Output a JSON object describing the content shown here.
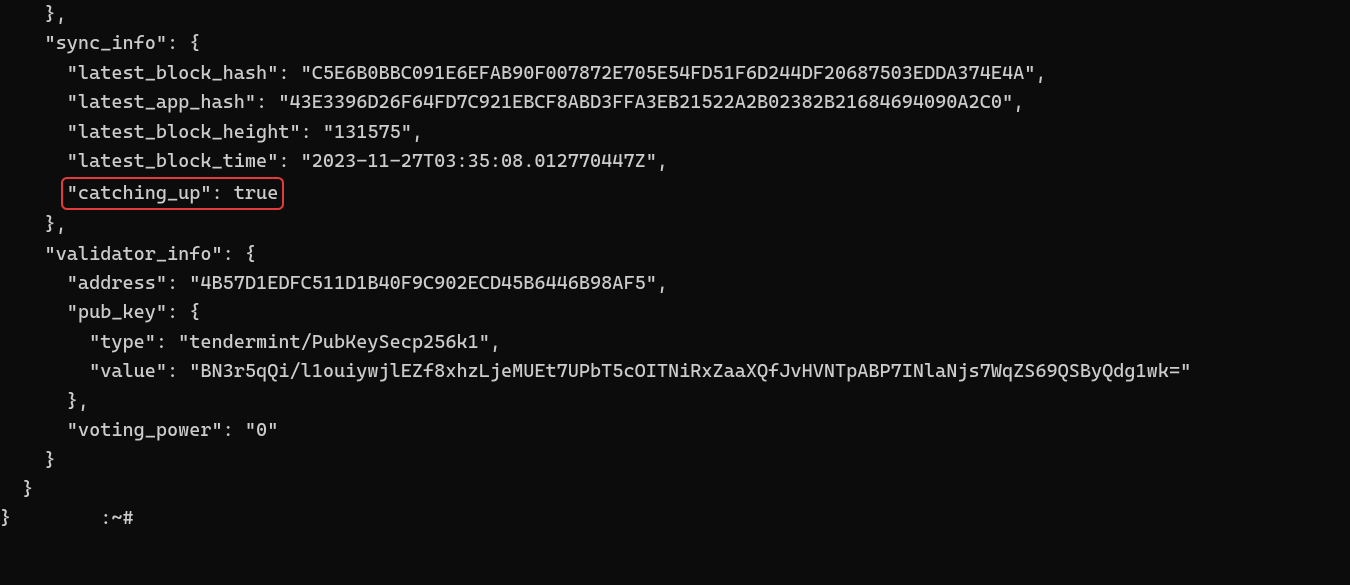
{
  "code": {
    "i0": "    },",
    "i1a": "    \"sync_info\": {",
    "i2": "      \"latest_block_hash\": \"C5E6B0BBC091E6EFAB90F007872E705E54FD51F6D244DF20687503EDDA374E4A\",",
    "i3": "      \"latest_app_hash\": \"43E3396D26F64FD7C921EBCF8ABD3FFA3EB21522A2B02382B21684694090A2C0\",",
    "i4": "      \"latest_block_height\": \"131575\",",
    "i5": "      \"latest_block_time\": \"2023-11-27T03:35:08.012770447Z\",",
    "i6p": "      ",
    "i6h": "\"catching_up\": true",
    "i7": "    },",
    "i8": "    \"validator_info\": {",
    "i9": "      \"address\": \"4B57D1EDFC511D1B40F9C902ECD45B6446B98AF5\",",
    "i10": "      \"pub_key\": {",
    "i11": "        \"type\": \"tendermint/PubKeySecp256k1\",",
    "i12": "        \"value\": \"BN3r5qQi/l1ouiywjlEZf8xhzLjeMUEt7UPbT5cOITNiRxZaaXQfJvHVNTpABP7INlaNjs7WqZS69QSByQdg1wk=\"",
    "i13": "      },",
    "i14": "      \"voting_power\": \"0\"",
    "i15": "    }",
    "i16": "  }",
    "i17a": "}",
    "i17b": "        ",
    "i17c": ":~#"
  }
}
